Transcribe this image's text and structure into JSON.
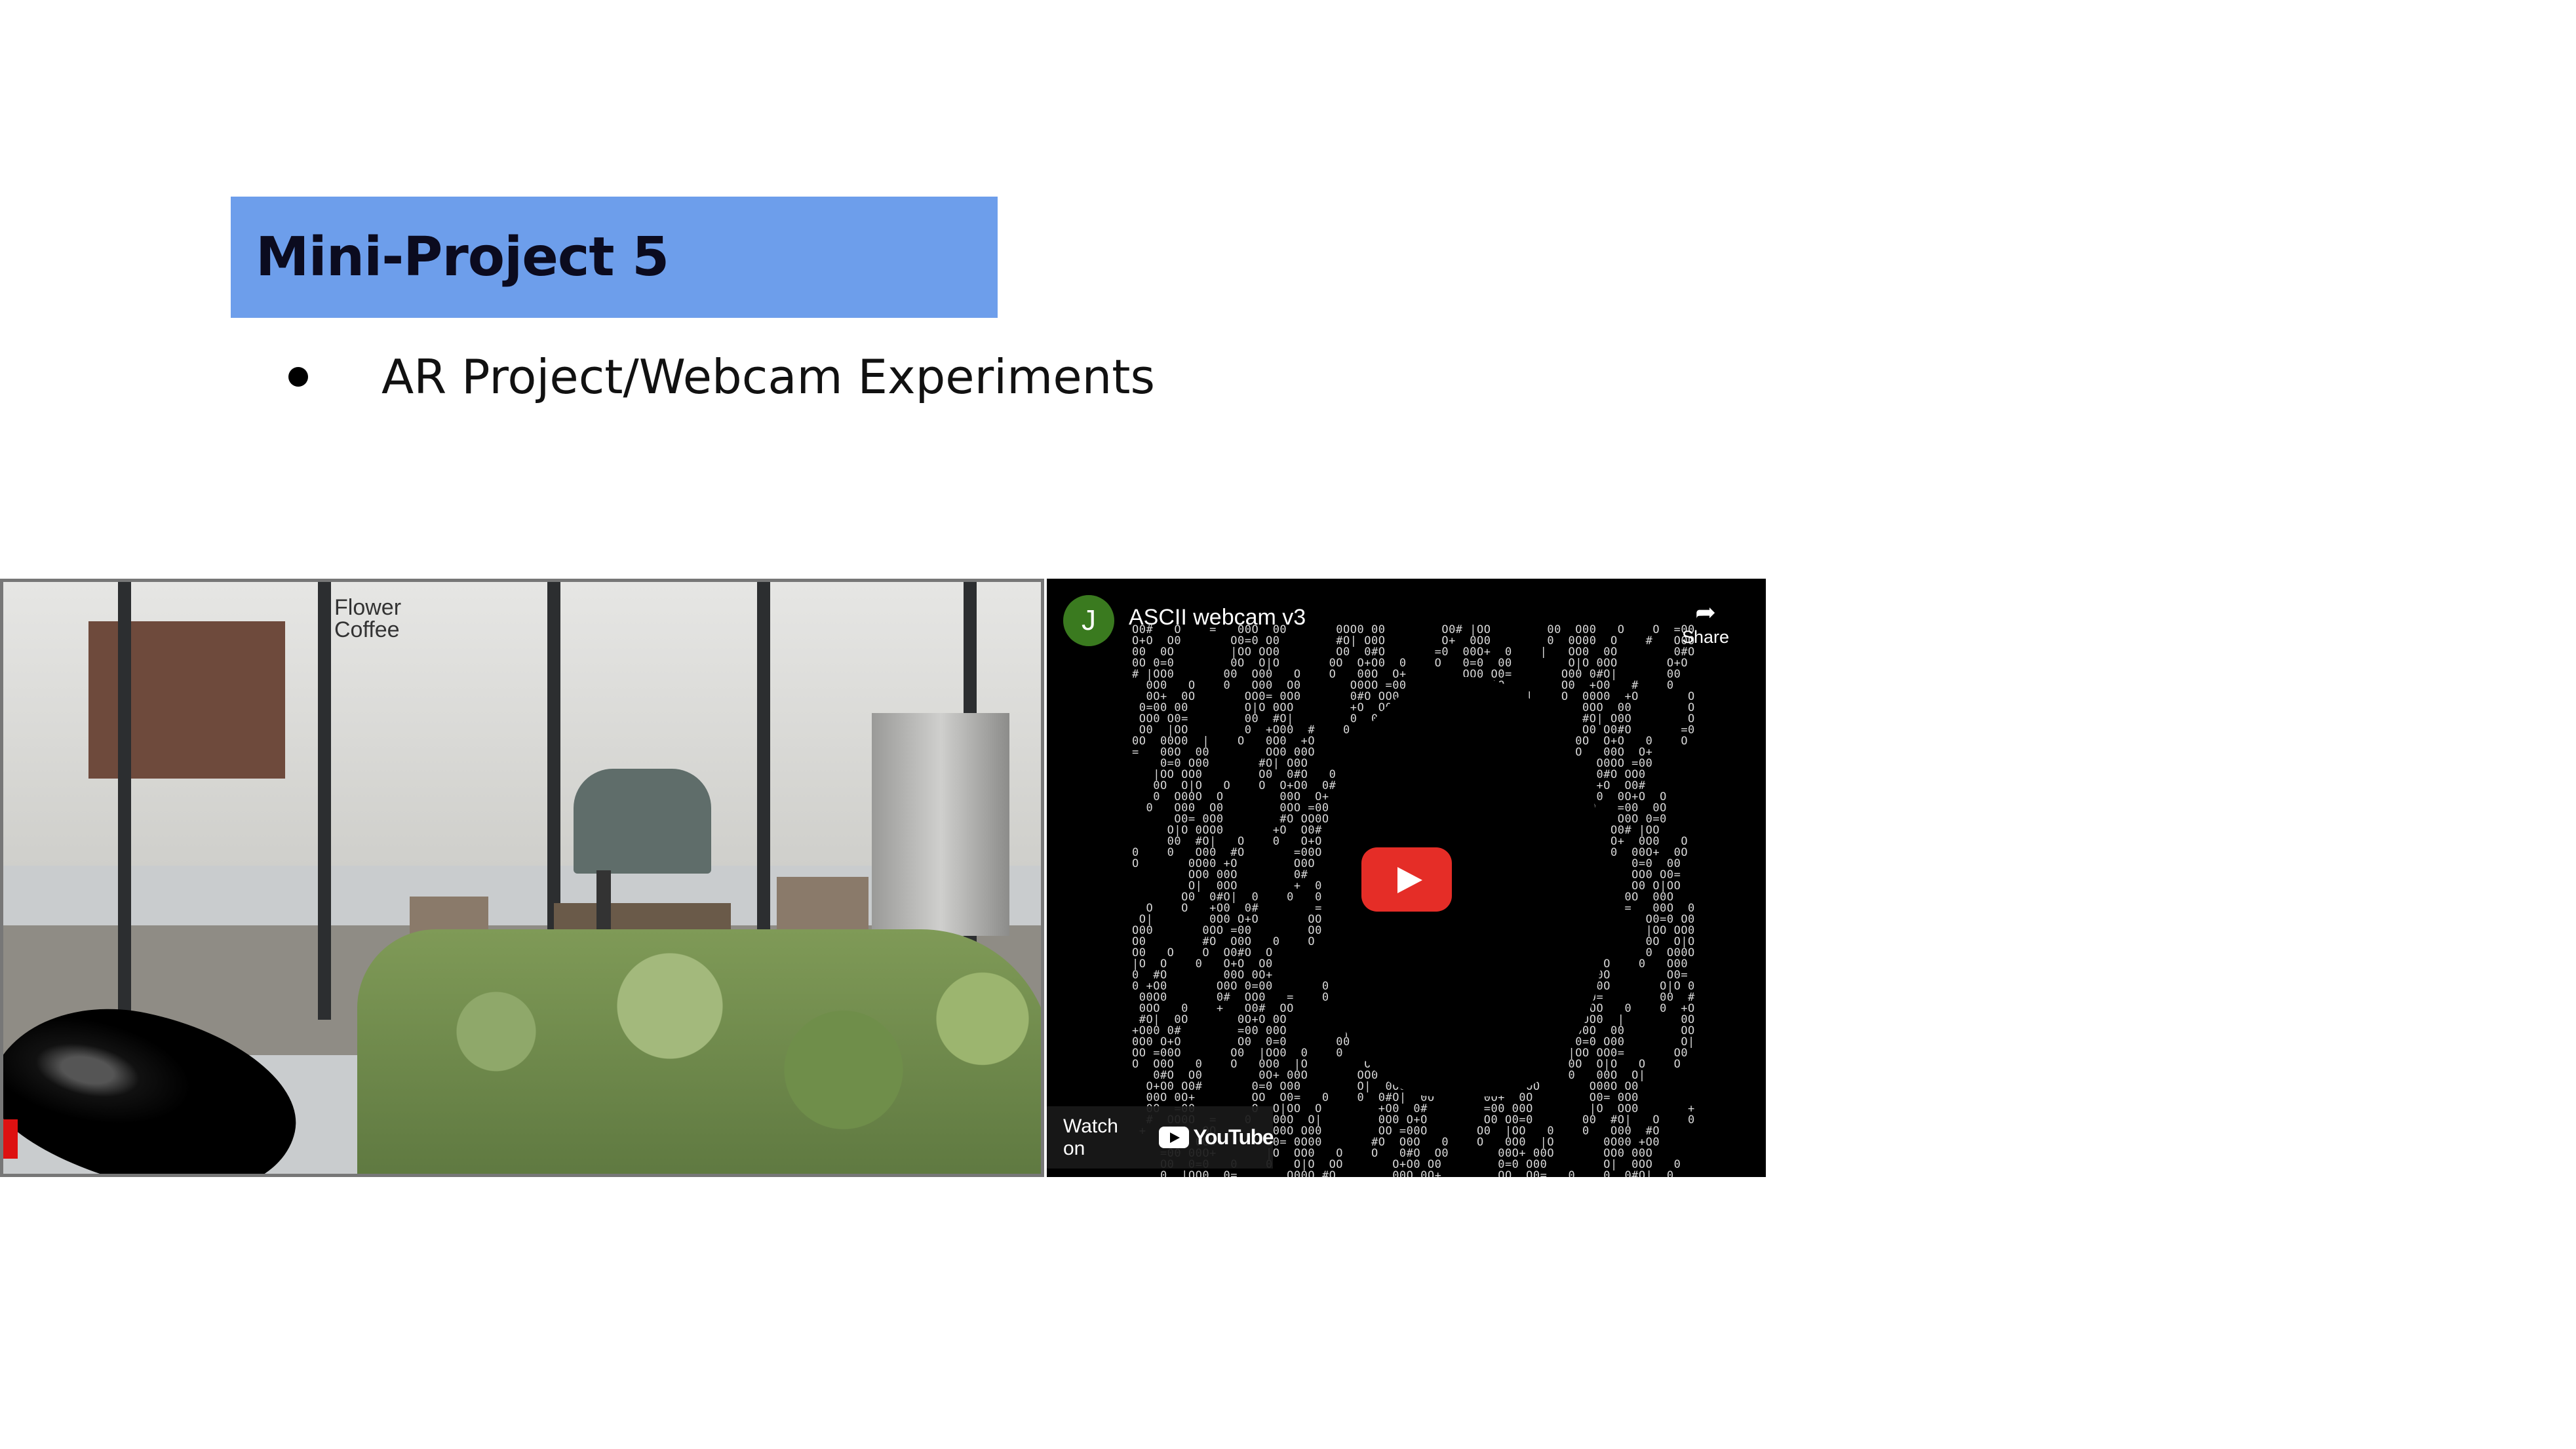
{
  "slide": {
    "title": "Mini-Project 5",
    "bullets": [
      "AR Project/Webcam Experiments"
    ],
    "title_color": "#6d9eeb"
  },
  "ar_image": {
    "sign_text": "Flower\nCoffee"
  },
  "youtube_embed": {
    "channel_initial": "J",
    "video_title": "ASCII webcam v3",
    "share_label": "Share",
    "watch_on_label": "Watch on",
    "brand_label": "YouTube",
    "play_color": "#e52d27"
  }
}
